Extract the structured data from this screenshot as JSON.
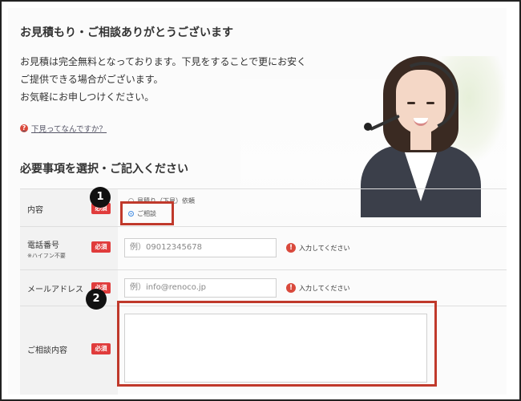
{
  "header": {
    "title": "お見積もり・ご相談ありがとうございます",
    "intro_lines": [
      "お見積は完全無料となっております。下見をすることで更にお安く",
      "ご提供できる場合がございます。",
      "お気軽にお申しつけください。"
    ],
    "help_link": "下見ってなんですか？",
    "help_icon": "?"
  },
  "form": {
    "section_title": "必要事項を選択・ご記入ください",
    "required_label": "必須",
    "warning_icon": "!",
    "rows": {
      "content": {
        "label": "内容",
        "options": [
          {
            "label": "見積り（下見）依頼",
            "selected": false
          },
          {
            "label": "ご相談",
            "selected": true
          }
        ]
      },
      "phone": {
        "label": "電話番号",
        "sub_label": "※ハイフン不要",
        "placeholder": "例）09012345678",
        "warning": "入力してください"
      },
      "email": {
        "label": "メールアドレス",
        "placeholder": "例）info@renoco.jp",
        "warning": "入力してください"
      },
      "consult": {
        "label": "ご相談内容",
        "value": ""
      }
    }
  },
  "annotations": {
    "badge1": "1",
    "badge2": "2",
    "highlight_color": "#c0392b"
  },
  "colors": {
    "required_bg": "#e03c3c",
    "radio_selected": "#4a90e2"
  }
}
